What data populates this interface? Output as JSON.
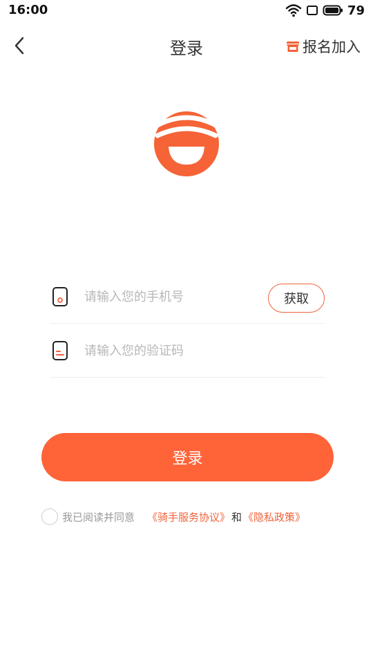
{
  "status_bar": {
    "time": "16:00",
    "battery": "79"
  },
  "nav": {
    "title": "登录",
    "join_label": "报名加入"
  },
  "form": {
    "phone_placeholder": "请输入您的手机号",
    "code_placeholder": "请输入您的验证码",
    "get_code_label": "获取"
  },
  "login_button": "登录",
  "agreement": {
    "prefix": "我已阅读并同意",
    "rider_agreement": "《骑手服务协议》",
    "and": "和",
    "privacy_policy": "《隐私政策》"
  },
  "colors": {
    "accent": "#ff6338",
    "link": "#f0623a"
  }
}
